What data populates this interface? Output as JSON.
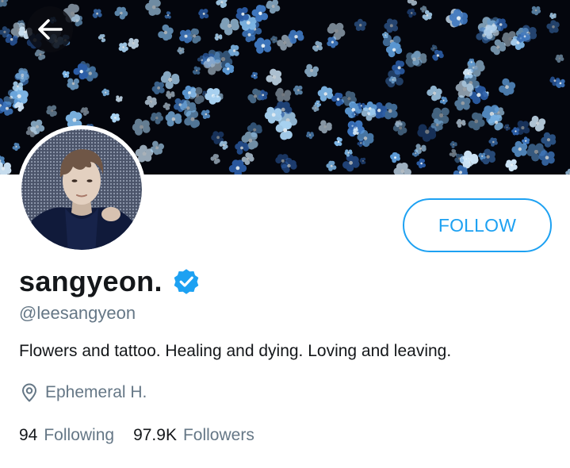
{
  "header": {
    "back_icon": "arrow-left-icon",
    "banner_image": "blue forget-me-not flowers at night"
  },
  "profile": {
    "avatar_image": "profile photo",
    "display_name": "sangyeon.",
    "verified_icon": "verified-badge-icon",
    "handle": "@leesangyeon",
    "bio": "Flowers and tattoo. Healing and dying. Loving and leaving.",
    "location_icon": "location-pin-icon",
    "location": "Ephemeral H.",
    "following_count": "94",
    "following_label": "Following",
    "followers_count": "97.9K",
    "followers_label": "Followers"
  },
  "actions": {
    "follow_label": "FOLLOW"
  },
  "colors": {
    "accent": "#1da1f2",
    "text_primary": "#14171a",
    "text_secondary": "#657786",
    "banner_bg": "#05070f"
  }
}
